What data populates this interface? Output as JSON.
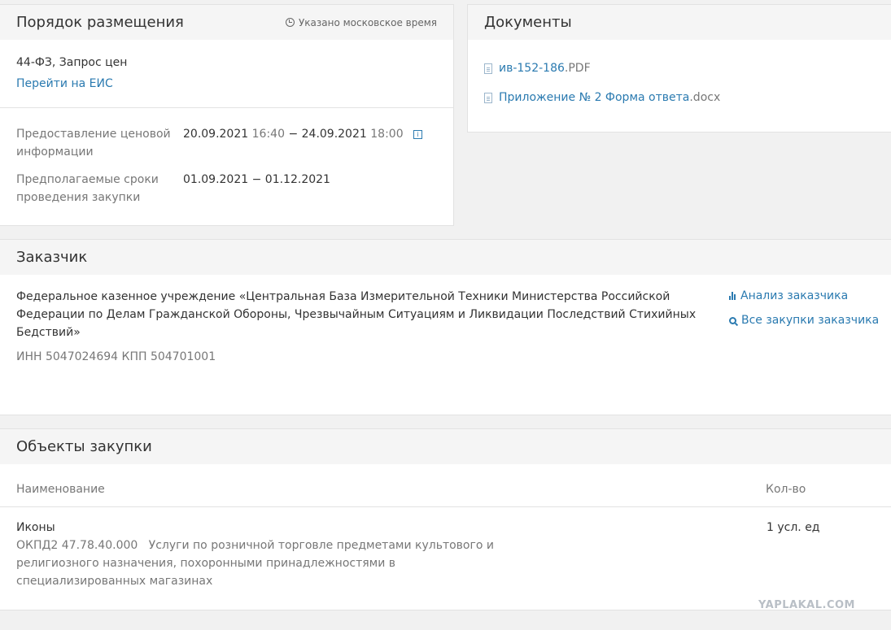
{
  "placement": {
    "title": "Порядок размещения",
    "timezone_note": "Указано московское время",
    "law_method": "44-ФЗ, Запрос цен",
    "eis_link": "Перейти на ЕИС",
    "price_info_label": "Предоставление ценовой информации",
    "price_info": {
      "start_date": "20.09.2021",
      "start_time": "16:40",
      "separator": "−",
      "end_date": "24.09.2021",
      "end_time": "18:00"
    },
    "terms_label": "Предполагаемые сроки проведения закупки",
    "terms_value": "01.09.2021 − 01.12.2021"
  },
  "documents": {
    "title": "Документы",
    "items": [
      {
        "name": "ив-152-186",
        "ext": ".PDF"
      },
      {
        "name": "Приложение № 2 Форма ответа",
        "ext": ".docx"
      }
    ]
  },
  "customer": {
    "title": "Заказчик",
    "name": "Федеральное казенное учреждение «Центральная База Измерительной Техники Министерства Российской Федерации по Делам Гражданской Обороны, Чрезвычайным Ситуациям и Ликвидации Последствий Стихийных Бедствий»",
    "ids": "ИНН 5047024694 КПП 504701001",
    "analysis_link": "Анализ заказчика",
    "all_purchases_link": "Все закупки заказчика"
  },
  "objects": {
    "title": "Объекты закупки",
    "col_name": "Наименование",
    "col_qty": "Кол-во",
    "rows": [
      {
        "name": "Иконы",
        "code": "ОКПД2 47.78.40.000",
        "description": "Услуги по розничной торговле предметами культового и религиозного назначения, похоронными принадлежностями в специализированных магазинах",
        "qty": "1 усл. ед"
      }
    ]
  },
  "watermark": "YAPLAKAL.COM",
  "icons": {
    "clock": "clock-icon",
    "info": "info-icon",
    "file": "file-icon",
    "chart": "bar-chart-icon",
    "search": "search-icon"
  },
  "colors": {
    "link": "#2a7ab0",
    "header_bg": "#f5f5f5",
    "page_bg": "#f1f1f1"
  }
}
